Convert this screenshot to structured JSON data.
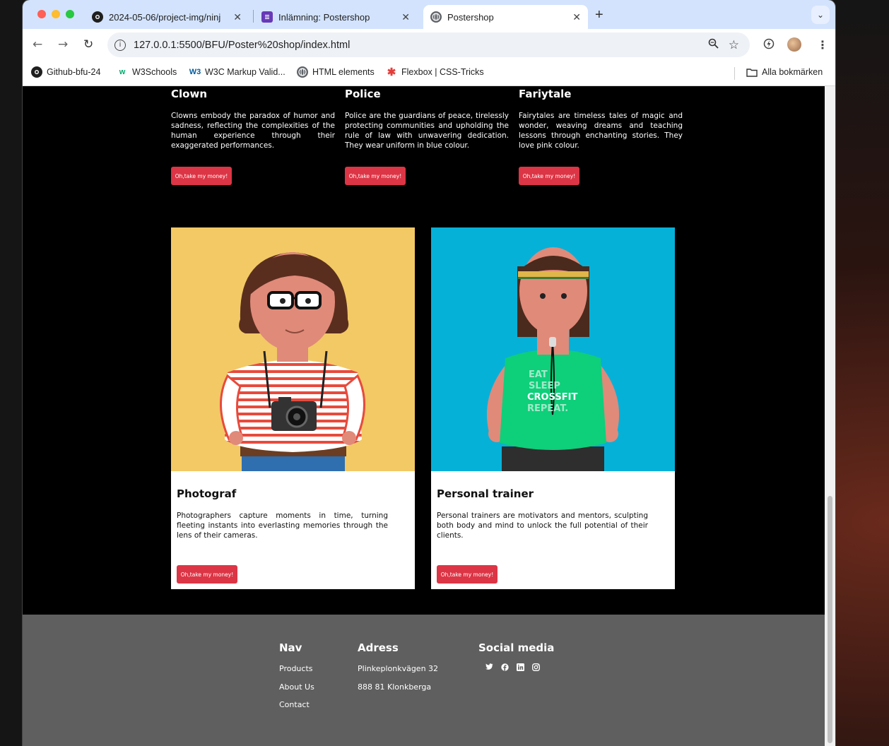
{
  "browser": {
    "tabs": [
      {
        "title": "2024-05-06/project-img/ninj",
        "icon": "github-icon"
      },
      {
        "title": "Inlämning: Postershop",
        "icon": "forms-icon"
      },
      {
        "title": "Postershop",
        "icon": "globe-icon"
      }
    ],
    "url": "127.0.0.1:5500/BFU/Poster%20shop/index.html",
    "bookmarks": [
      {
        "label": "Github-bfu-24",
        "icon": "github-icon"
      },
      {
        "label": "W3Schools",
        "icon": "w3schools-icon"
      },
      {
        "label": "W3C Markup Valid...",
        "icon": "w3c-icon"
      },
      {
        "label": "HTML elements",
        "icon": "globe-icon"
      },
      {
        "label": "Flexbox | CSS-Tricks",
        "icon": "css-tricks-icon"
      }
    ],
    "all_bookmarks": "Alla bokmärken"
  },
  "top_cards": [
    {
      "title": "Clown",
      "text": "Clowns embody the paradox of humor and sadness, reflecting the complexities of the human experience through their exaggerated performances.",
      "button": "Oh,take my money!"
    },
    {
      "title": "Police",
      "text": "Police are the guardians of peace, tirelessly protecting communities and upholding the rule of law with unwavering dedication. They wear uniform in blue colour.",
      "button": "Oh,take my money!"
    },
    {
      "title": "Fariytale",
      "text": "Fairytales are timeless tales of magic and wonder, weaving dreams and teaching lessons through enchanting stories. They love pink colour.",
      "button": "Oh,take my money!"
    }
  ],
  "cards": [
    {
      "title": "Photograf",
      "text": "Photographers capture moments in time, turning fleeting instants into everlasting memories through the lens of their cameras.",
      "button": "Oh,take my money!",
      "bg": "#f2c965"
    },
    {
      "title": "Personal trainer",
      "text": "Personal trainers are motivators and mentors, sculpting both body and mind to unlock the full potential of their clients.",
      "button": "Oh,take my money!",
      "bg": "#06b1d8",
      "shirt_lines": [
        "EAT",
        "SLEEP",
        "CROSSFIT",
        "REPEAT."
      ]
    }
  ],
  "footer": {
    "nav": {
      "title": "Nav",
      "items": [
        "Products",
        "About Us",
        "Contact"
      ]
    },
    "address": {
      "title": "Adress",
      "lines": [
        "Plinkeplonkvägen 32",
        "888 81 Klonkberga"
      ]
    },
    "social": {
      "title": "Social media",
      "icons": [
        "twitter-icon",
        "facebook-icon",
        "linkedin-icon",
        "instagram-icon"
      ]
    }
  },
  "colors": {
    "button": "#dc3545",
    "footer": "#5f5f5f",
    "tabbar": "#d3e3fd"
  }
}
